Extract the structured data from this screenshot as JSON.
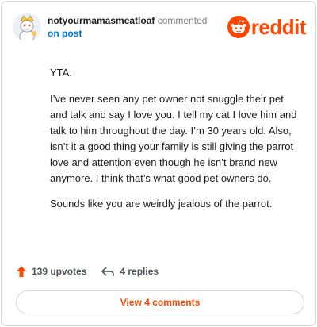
{
  "header": {
    "username": "notyourmamasmeatloaf",
    "action": "commented",
    "action_target": "on post",
    "brand": "reddit",
    "brand_color": "#ff4500",
    "avatar_icon": "snoo-avatar-icon"
  },
  "comment": {
    "paragraphs": [
      "YTA.",
      "I’ve never seen any pet owner not snuggle their pet and talk and say I love you. I tell my cat I love him and talk to him throughout the day. I’m 30 years old. Also, isn’t it a good thing your family is still giving the parrot love and attention even though he isn’t brand new anymore. I think that’s what good pet owners do.",
      "Sounds like you are weirdly jealous of the parrot."
    ]
  },
  "stats": {
    "upvotes": "139 upvotes",
    "replies": "4 replies",
    "upvote_icon": "upvote-arrow-icon",
    "reply_icon": "reply-arrow-icon"
  },
  "footer": {
    "view_comments": "View 4 comments"
  }
}
